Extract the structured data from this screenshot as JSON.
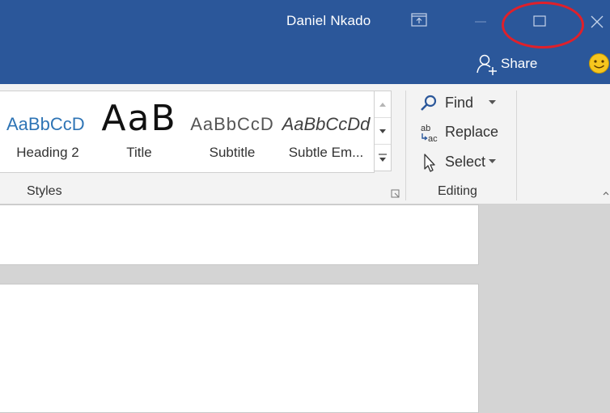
{
  "titlebar": {
    "user_name": "Daniel Nkado",
    "share_label": "Share"
  },
  "ribbon": {
    "styles_group": {
      "label": "Styles",
      "items": [
        {
          "preview": "AaBbCcD",
          "name": "Heading 2"
        },
        {
          "preview": "AaB",
          "name": "Title"
        },
        {
          "preview": "AaBbCcD",
          "name": "Subtitle"
        },
        {
          "preview": "AaBbCcDd",
          "name": "Subtle Em..."
        }
      ]
    },
    "editing_group": {
      "label": "Editing",
      "find_label": "Find",
      "replace_label": "Replace",
      "select_label": "Select"
    }
  },
  "colors": {
    "titlebar_blue": "#2b579a",
    "annotation_red": "#e0202a",
    "heading_blue": "#2e74b5"
  },
  "icons": [
    "restore-ribbon-icon",
    "minimize-icon",
    "maximize-icon",
    "close-icon",
    "share-person-icon",
    "smiley-icon",
    "find-magnifier-icon",
    "replace-icon",
    "select-cursor-icon",
    "dialog-launcher-icon"
  ]
}
